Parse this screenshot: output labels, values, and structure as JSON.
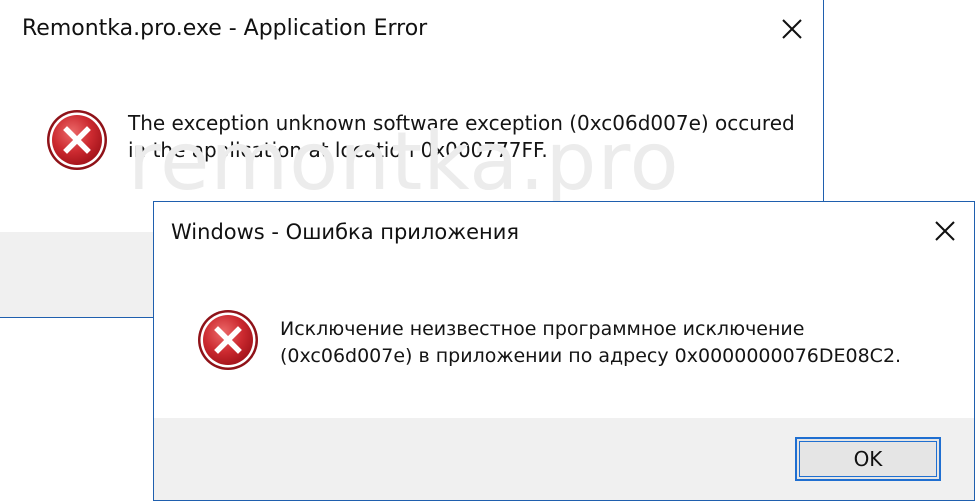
{
  "watermark": {
    "text": "remontka.pro"
  },
  "dialog_english": {
    "title": "Remontka.pro.exe - Application Error",
    "message_line1": "The exception unknown software exception (0xc06d007e) occured",
    "message_line2": "in the application at location 0x000777FF.",
    "icon": "error-icon",
    "close_icon": "close-icon"
  },
  "dialog_russian": {
    "title": "Windows - Ошибка приложения",
    "message_line1": "Исключение неизвестное программное исключение",
    "message_line2": "(0xc06d007e) в приложении по адресу 0x0000000076DE08C2.",
    "icon": "error-icon",
    "close_icon": "close-icon",
    "ok_label": "OK"
  },
  "colors": {
    "window_border": "#1f5fae",
    "footer_bg": "#f0f0f0",
    "error_red": "#c8242b",
    "button_focus": "#1f6fd1"
  }
}
